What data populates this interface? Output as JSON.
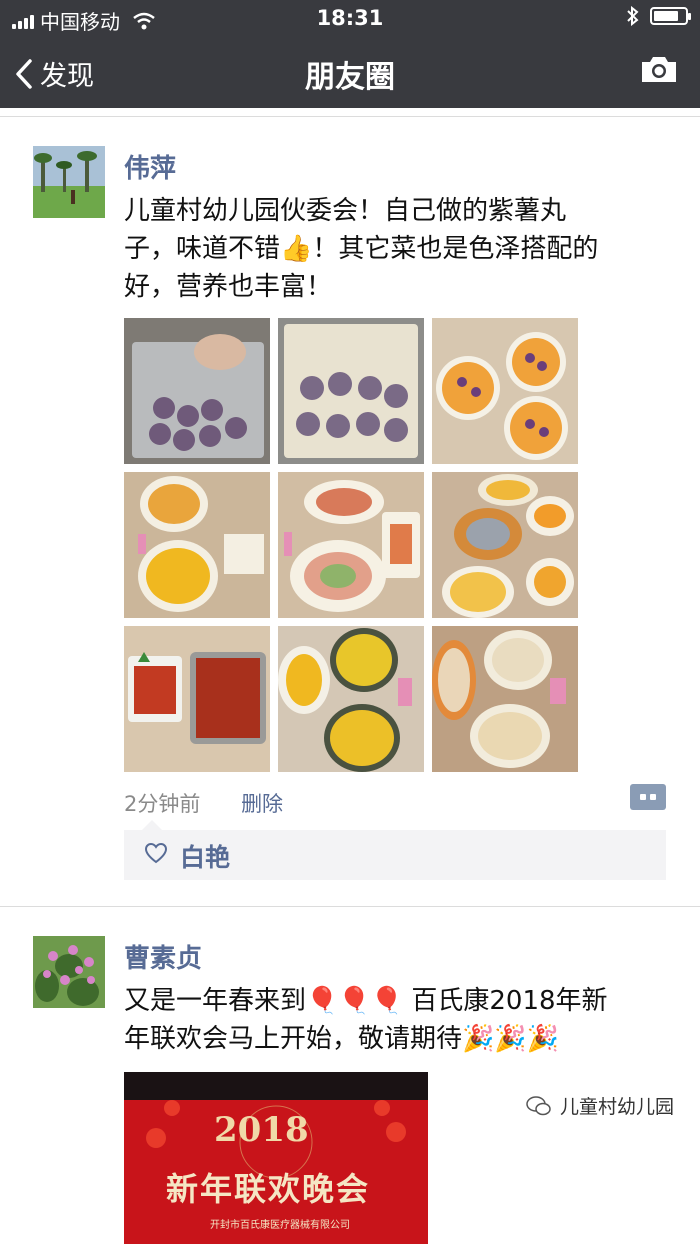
{
  "status_bar": {
    "carrier": "中国移动",
    "time": "18:31",
    "signal_bars": 4,
    "battery_level": 0.8
  },
  "nav": {
    "back_label": "发现",
    "title": "朋友圈",
    "camera_icon": "camera-icon"
  },
  "posts": [
    {
      "author": "伟萍",
      "text_lines": [
        "儿童村幼儿园伙委会！自己做的紫薯丸",
        "子，味道不错👍！其它菜也是色泽搭配的",
        "好，营养也丰富！"
      ],
      "photo_count": 9,
      "time_ago": "2分钟前",
      "delete_label": "删除",
      "likes": [
        "白艳"
      ]
    },
    {
      "author": "曹素贞",
      "text_lines": [
        "又是一年春来到🎈🎈🎈 百氏康2018年新",
        "年联欢会马上开始，敬请期待🎉🎉🎉"
      ],
      "banner": {
        "year": "2018",
        "headline": "新年联欢晚会",
        "subline": "开封市百氏康医疗器械有限公司"
      }
    }
  ],
  "watermark": {
    "label": "儿童村幼儿园"
  },
  "colors": {
    "nav_bg": "#393a3f",
    "name_link": "#576b95",
    "meta_gray": "#8a8a8a"
  }
}
